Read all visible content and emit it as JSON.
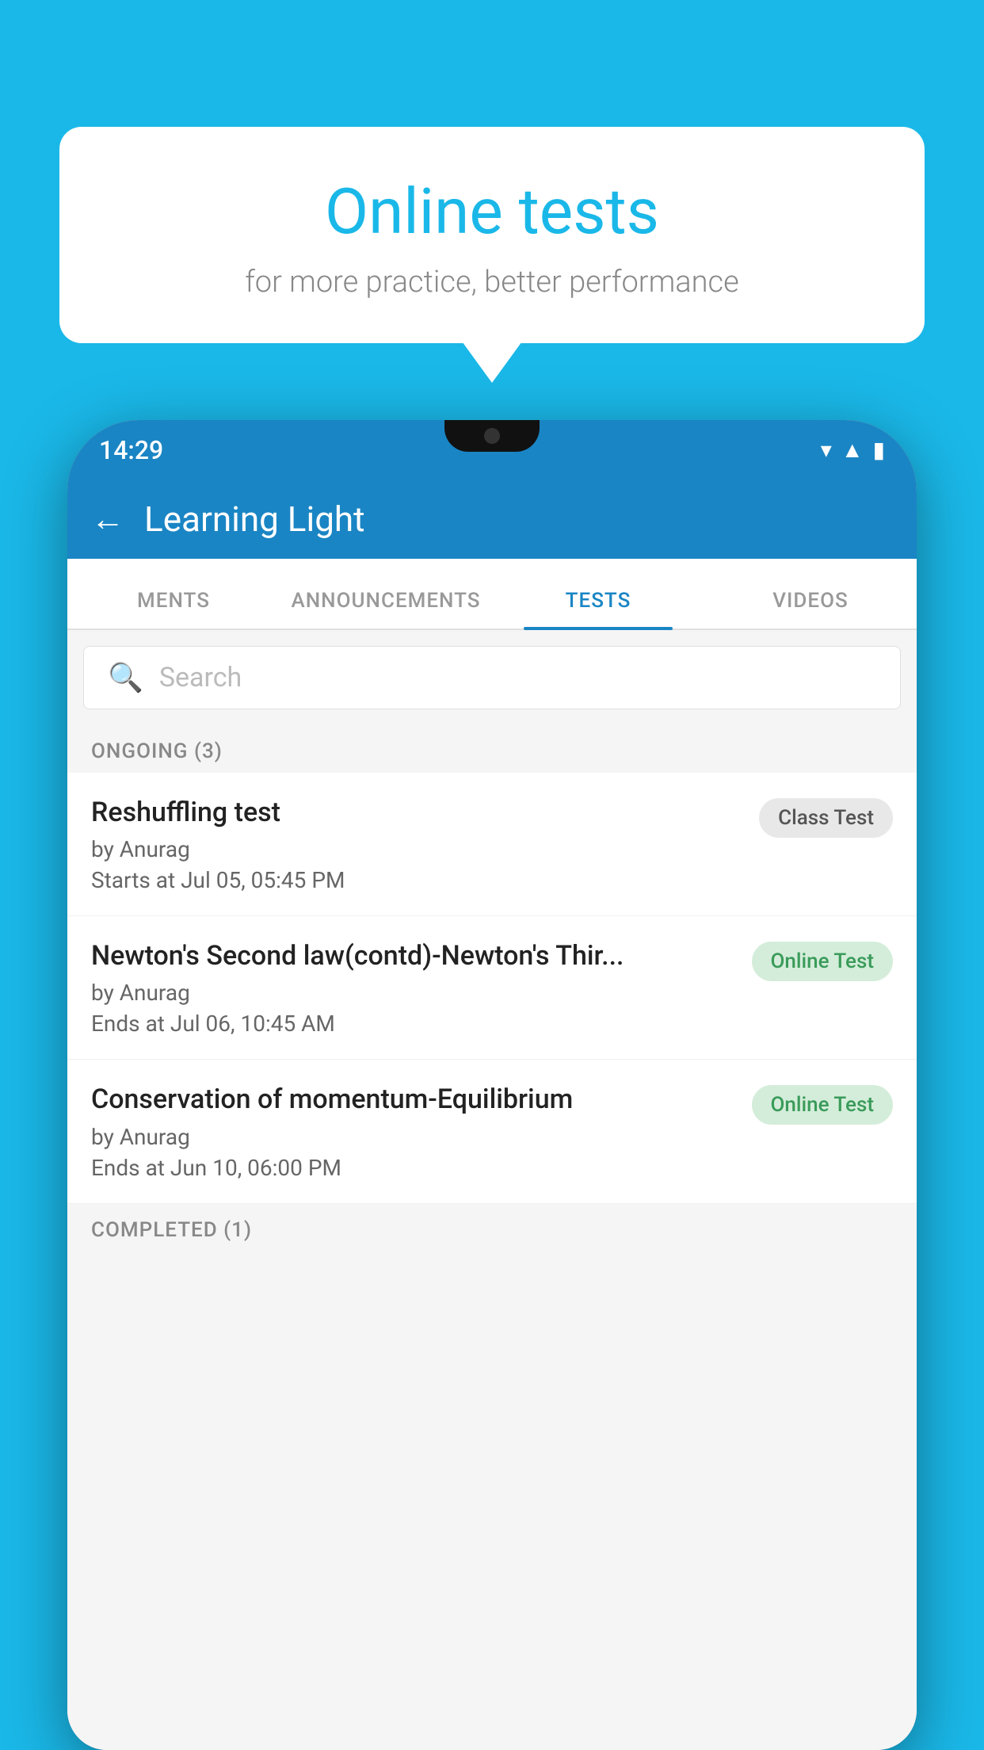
{
  "background": {
    "color": "#1ab8e8"
  },
  "speech_bubble": {
    "title": "Online tests",
    "subtitle": "for more practice, better performance"
  },
  "phone": {
    "status_bar": {
      "time": "14:29",
      "icons": [
        "wifi",
        "signal",
        "battery"
      ]
    },
    "app_header": {
      "title": "Learning Light",
      "back_label": "←"
    },
    "tabs": [
      {
        "label": "MENTS",
        "active": false
      },
      {
        "label": "ANNOUNCEMENTS",
        "active": false
      },
      {
        "label": "TESTS",
        "active": true
      },
      {
        "label": "VIDEOS",
        "active": false
      }
    ],
    "search": {
      "placeholder": "Search"
    },
    "sections": [
      {
        "header": "ONGOING (3)",
        "items": [
          {
            "name": "Reshuffling test",
            "author": "by Anurag",
            "time_label": "Starts at",
            "time": "Jul 05, 05:45 PM",
            "badge": "Class Test",
            "badge_type": "class"
          },
          {
            "name": "Newton's Second law(contd)-Newton's Thir...",
            "author": "by Anurag",
            "time_label": "Ends at",
            "time": "Jul 06, 10:45 AM",
            "badge": "Online Test",
            "badge_type": "online"
          },
          {
            "name": "Conservation of momentum-Equilibrium",
            "author": "by Anurag",
            "time_label": "Ends at",
            "time": "Jun 10, 06:00 PM",
            "badge": "Online Test",
            "badge_type": "online"
          }
        ]
      },
      {
        "header": "COMPLETED (1)",
        "items": []
      }
    ]
  }
}
